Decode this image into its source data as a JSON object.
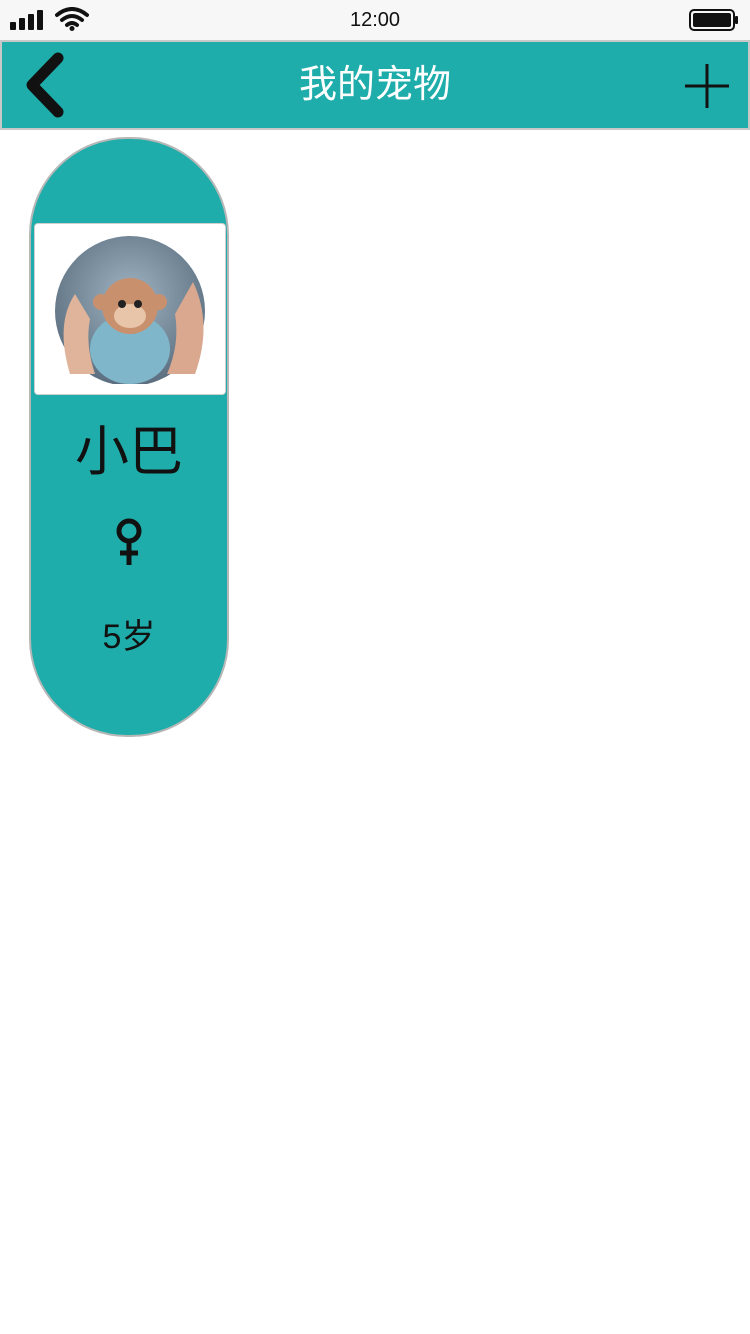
{
  "status_bar": {
    "time": "12:00",
    "icons": [
      "signal-icon",
      "wifi-icon",
      "battery-icon"
    ]
  },
  "nav": {
    "title": "我的宠物",
    "back_icon": "chevron-left-icon",
    "add_icon": "plus-icon"
  },
  "pets": [
    {
      "name": "小巴",
      "gender_icon": "female-icon",
      "age": "5岁",
      "avatar": "monkey-plush-photo"
    }
  ],
  "colors": {
    "accent": "#1eadaa",
    "border": "#c8c8c8",
    "text": "#111111",
    "title_text": "#ffffff"
  }
}
